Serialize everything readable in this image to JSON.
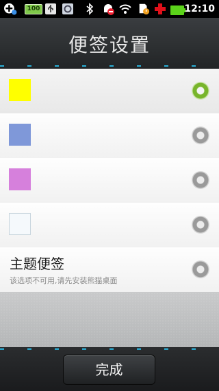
{
  "status_bar": {
    "time": "12:10",
    "battery_label": "100"
  },
  "header": {
    "title": "便签设置"
  },
  "note_colors": [
    {
      "color": "#ffff00",
      "selected": true
    },
    {
      "color": "#7f98d9",
      "selected": false
    },
    {
      "color": "#d680dc",
      "selected": false
    },
    {
      "color": "#f5f9fc",
      "selected": false
    }
  ],
  "theme_option": {
    "title": "主题便签",
    "subtitle": "该选项不可用,请先安装熊猫桌面",
    "selected": false
  },
  "footer": {
    "done_label": "完成"
  }
}
